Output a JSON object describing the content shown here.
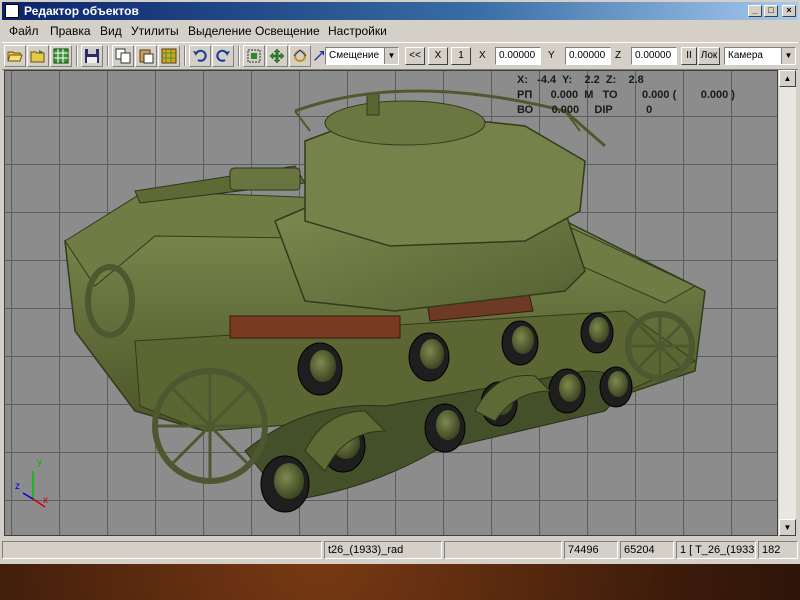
{
  "window": {
    "title": "Редактор объектов"
  },
  "caption_buttons": {
    "minimize": "_",
    "maximize": "□",
    "close": "×"
  },
  "menu": [
    "Файл",
    "Правка",
    "Вид",
    "Утилиты",
    "Выделение",
    "Освещение",
    "Настройки"
  ],
  "toolbar": {
    "mode_select": "Смещение",
    "prev_label": "<<",
    "x_btn": "X",
    "one_btn": "1",
    "x_label": "X",
    "x_value": "0.00000",
    "y_label": "Y",
    "y_value": "0.00000",
    "z_label": "Z",
    "z_value": "0.00000",
    "pause_label": "II",
    "lock_label": "Лок",
    "view_select": "Камера"
  },
  "viewport": {
    "overlay_lines": [
      "X:   -4.4  Y:    2.2  Z:    2.8",
      "РП      0.000  М   ТО        0.000 (        0.000 )",
      "ВО      0.000     DIP           0"
    ],
    "axis_labels": {
      "x": "x",
      "y": "y",
      "z": "z"
    },
    "colors": {
      "background": "#8c8c8c",
      "grid": "#5d5d5d",
      "tank_body": "#5f6e3a"
    }
  },
  "statusbar": {
    "panels": [
      "",
      "t26_(1933)_rad",
      "",
      "74496",
      "65204",
      "1 [ T_26_(1933",
      "182"
    ]
  }
}
